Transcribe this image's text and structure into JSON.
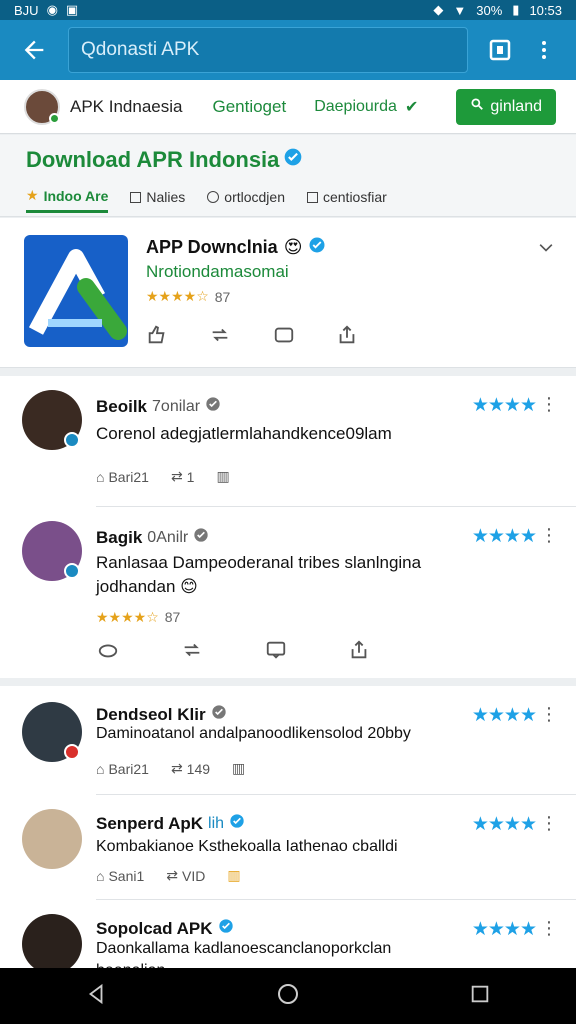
{
  "status": {
    "left": "BJU",
    "battery": "30%",
    "time": "10:53"
  },
  "appbar": {
    "search_text": "Qdonasti APK"
  },
  "topbar": {
    "brand": "APK Indnaesia",
    "tab1": "Gentioget",
    "tab2": "Daepiourda",
    "install_label": "ginland"
  },
  "page": {
    "title": "Download APR Indonsia",
    "subtabs": [
      "Indoo Are",
      "Nalies",
      "ortlocdjen",
      "centiosfiar"
    ]
  },
  "app": {
    "name": "APP Downclnia",
    "developer": "Nrotiondamasomai",
    "rating_count": "87"
  },
  "reviews": [
    {
      "name": "Beoilk",
      "sub": "7onilar",
      "text": "Corenol adegjatlermlahandkence09lam",
      "meta": [
        "Bari21",
        "1"
      ]
    },
    {
      "name": "Bagik",
      "sub": "0Anilr",
      "text": "Ranlasaa Dampeoderanal tribes slanlngina jodhandan",
      "stars_count": "87"
    },
    {
      "name": "Dendseol Klir",
      "sub": "",
      "text": "Daminoatanol andalpanoodlikensolod 20bby",
      "meta": [
        "Bari21",
        "149"
      ]
    },
    {
      "name": "Senperd ApK",
      "sub": "lih",
      "text": "Kombakianoe Ksthekoalla Iathenao cballdi",
      "meta": [
        "Sani1",
        "VID"
      ]
    },
    {
      "name": "Sopolcad APK",
      "sub": "",
      "text": "Daonkallama kadlanoescanclanoporkclan",
      "text2": "beenalian"
    }
  ],
  "colors": {
    "accent": "#1a8ac1",
    "green": "#1c8a3a",
    "star_blue": "#1ea1e6",
    "star_gold": "#e5a21b"
  }
}
